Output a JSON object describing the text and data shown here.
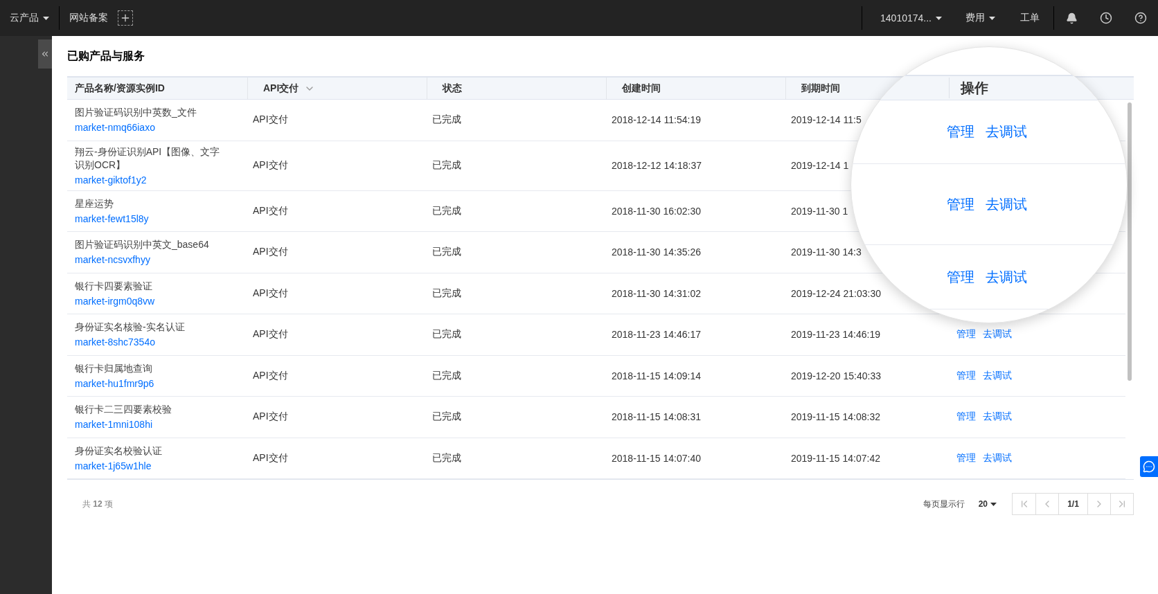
{
  "topbar": {
    "product_menu": "云产品",
    "filing_link": "网站备案",
    "account": "14010174...",
    "billing": "费用",
    "tickets": "工单"
  },
  "page_title": "已购产品与服务",
  "table": {
    "columns": [
      {
        "label": "产品名称/资源实例ID",
        "sortable": false
      },
      {
        "label": "API交付",
        "sortable": true
      },
      {
        "label": "状态",
        "sortable": false
      },
      {
        "label": "创建时间",
        "sortable": false
      },
      {
        "label": "到期时间",
        "sortable": false
      }
    ],
    "rows": [
      {
        "name": "图片验证码识别中英数_文件",
        "id": "market-nmq66iaxo",
        "delivery": "API交付",
        "status": "已完成",
        "created": "2018-12-14 11:54:19",
        "expiry": "2019-12-14 11:5"
      },
      {
        "name": "翔云-身份证识别API【图像、文字识别OCR】",
        "id": "market-giktof1y2",
        "delivery": "API交付",
        "status": "已完成",
        "created": "2018-12-12 14:18:37",
        "expiry": "2019-12-14 1"
      },
      {
        "name": "星座运势",
        "id": "market-fewt15l8y",
        "delivery": "API交付",
        "status": "已完成",
        "created": "2018-11-30 16:02:30",
        "expiry": "2019-11-30 1"
      },
      {
        "name": "图片验证码识别中英文_base64",
        "id": "market-ncsvxfhyy",
        "delivery": "API交付",
        "status": "已完成",
        "created": "2018-11-30 14:35:26",
        "expiry": "2019-11-30 14:3"
      },
      {
        "name": "银行卡四要素验证",
        "id": "market-irgm0q8vw",
        "delivery": "API交付",
        "status": "已完成",
        "created": "2018-11-30 14:31:02",
        "expiry": "2019-12-24 21:03:30"
      },
      {
        "name": "身份证实名核验-实名认证",
        "id": "market-8shc7354o",
        "delivery": "API交付",
        "status": "已完成",
        "created": "2018-11-23 14:46:17",
        "expiry": "2019-11-23 14:46:19",
        "actions": [
          "管理",
          "去调试"
        ]
      },
      {
        "name": "银行卡归属地查询",
        "id": "market-hu1fmr9p6",
        "delivery": "API交付",
        "status": "已完成",
        "created": "2018-11-15 14:09:14",
        "expiry": "2019-12-20 15:40:33",
        "actions": [
          "管理",
          "去调试"
        ]
      },
      {
        "name": "银行卡二三四要素校验",
        "id": "market-1mni108hi",
        "delivery": "API交付",
        "status": "已完成",
        "created": "2018-11-15 14:08:31",
        "expiry": "2019-11-15 14:08:32",
        "actions": [
          "管理",
          "去调试"
        ]
      },
      {
        "name": "身份证实名校验认证",
        "id": "market-1j65w1hle",
        "delivery": "API交付",
        "status": "已完成",
        "created": "2018-11-15 14:07:40",
        "expiry": "2019-11-15 14:07:42",
        "actions": [
          "管理",
          "去调试"
        ]
      }
    ]
  },
  "magnifier": {
    "header": "操作",
    "rows": [
      {
        "actions": [
          "管理",
          "去调试"
        ]
      },
      {
        "actions": [
          "管理",
          "去调试"
        ]
      },
      {
        "actions": [
          "管理",
          "去调试"
        ]
      }
    ]
  },
  "footer": {
    "total": "共 **12** 项",
    "page_size_label": "每页显示行",
    "page_size": "20",
    "pager": [
      {
        "kind": "first",
        "disabled": true
      },
      {
        "kind": "prev",
        "disabled": true
      },
      {
        "kind": "page",
        "label": "1/1",
        "disabled": false
      },
      {
        "kind": "next",
        "disabled": true
      },
      {
        "kind": "last",
        "disabled": true
      }
    ]
  }
}
